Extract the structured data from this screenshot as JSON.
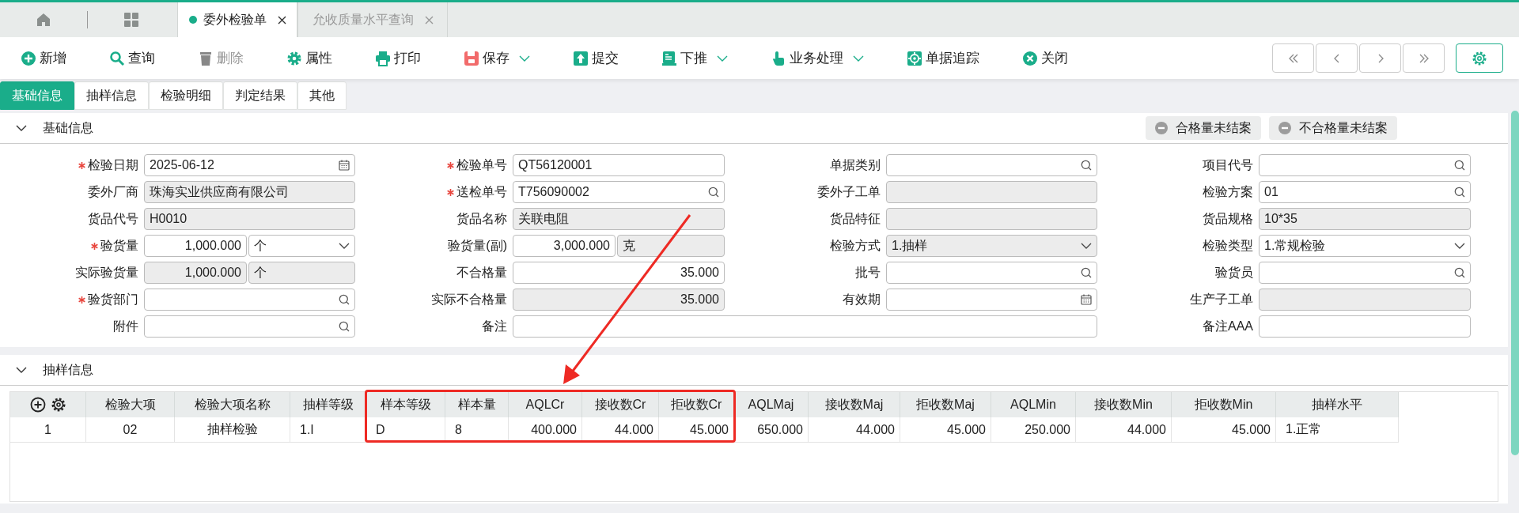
{
  "page_tabs": [
    {
      "label": "委外检验单",
      "selected": true
    },
    {
      "label": "允收质量水平查询",
      "selected": false
    }
  ],
  "toolbar": [
    {
      "label": "新增",
      "kind": "plus",
      "disabled": false,
      "dropdown": false
    },
    {
      "label": "查询",
      "kind": "search",
      "disabled": false,
      "dropdown": false
    },
    {
      "label": "删除",
      "kind": "trash",
      "disabled": true,
      "dropdown": false
    },
    {
      "label": "属性",
      "kind": "gear",
      "disabled": false,
      "dropdown": false
    },
    {
      "label": "打印",
      "kind": "printer",
      "disabled": false,
      "dropdown": false
    },
    {
      "label": "保存",
      "kind": "save",
      "disabled": false,
      "dropdown": true
    },
    {
      "label": "提交",
      "kind": "upload",
      "disabled": false,
      "dropdown": false
    },
    {
      "label": "下推",
      "kind": "document",
      "disabled": false,
      "dropdown": true
    },
    {
      "label": "业务处理",
      "kind": "hand",
      "disabled": false,
      "dropdown": true
    },
    {
      "label": "单据追踪",
      "kind": "target",
      "disabled": false,
      "dropdown": false
    },
    {
      "label": "关闭",
      "kind": "close",
      "disabled": false,
      "dropdown": false
    }
  ],
  "form_tabs": [
    {
      "label": "基础信息",
      "selected": true
    },
    {
      "label": "抽样信息",
      "selected": false
    },
    {
      "label": "检验明细",
      "selected": false
    },
    {
      "label": "判定结果",
      "selected": false
    },
    {
      "label": "其他",
      "selected": false
    }
  ],
  "basic_section": {
    "title": "基础信息",
    "expanded": true,
    "status_buttons": [
      "合格量未结案",
      "不合格量未结案"
    ],
    "rows": [
      [
        {
          "label": "检验日期",
          "required": true,
          "kind": "date",
          "readonly": false,
          "value": "2025-06-12"
        },
        {
          "label": "检验单号",
          "required": true,
          "kind": "text",
          "readonly": false,
          "value": "QT56120001"
        },
        {
          "label": "单据类别",
          "required": false,
          "kind": "search",
          "readonly": false
        },
        {
          "label": "项目代号",
          "required": false,
          "kind": "search",
          "readonly": false
        }
      ],
      [
        {
          "label": "委外厂商",
          "required": false,
          "kind": "text",
          "readonly": true,
          "value": "珠海实业供应商有限公司"
        },
        {
          "label": "送检单号",
          "required": true,
          "kind": "search",
          "readonly": false,
          "value": "T756090002"
        },
        {
          "label": "委外子工单",
          "required": false,
          "kind": "text",
          "readonly": true
        },
        {
          "label": "检验方案",
          "required": false,
          "kind": "search",
          "readonly": false,
          "value": "01"
        }
      ],
      [
        {
          "label": "货品代号",
          "required": false,
          "kind": "text",
          "readonly": true,
          "value": "H0010"
        },
        {
          "label": "货品名称",
          "required": false,
          "kind": "text",
          "readonly": true,
          "value": "关联电阻"
        },
        {
          "label": "货品特征",
          "required": false,
          "kind": "text",
          "readonly": true
        },
        {
          "label": "货品规格",
          "required": false,
          "kind": "text",
          "readonly": true,
          "value": "10*35"
        }
      ],
      [
        {
          "label": "验货量",
          "required": true,
          "kind": "quantity",
          "readonly": false,
          "value": "1,000.000",
          "unit": {
            "value": "个",
            "kind": "select",
            "readonly": false
          }
        },
        {
          "label": "验货量(副)",
          "required": false,
          "kind": "quantity",
          "readonly": false,
          "value": "3,000.000",
          "unit": {
            "value": "克",
            "kind": "text",
            "readonly": true
          }
        },
        {
          "label": "检验方式",
          "required": false,
          "kind": "select",
          "readonly": true,
          "value": "1.抽样"
        },
        {
          "label": "检验类型",
          "required": false,
          "kind": "select",
          "readonly": false,
          "value": "1.常规检验"
        }
      ],
      [
        {
          "label": "实际验货量",
          "required": false,
          "kind": "quantity",
          "readonly": true,
          "value": "1,000.000",
          "unit": {
            "value": "个",
            "kind": "text",
            "readonly": true
          }
        },
        {
          "label": "不合格量",
          "required": false,
          "kind": "number",
          "readonly": false,
          "value": "35.000"
        },
        {
          "label": "批号",
          "required": false,
          "kind": "search",
          "readonly": false
        },
        {
          "label": "验货员",
          "required": false,
          "kind": "search",
          "readonly": false
        }
      ],
      [
        {
          "label": "验货部门",
          "required": true,
          "kind": "search",
          "readonly": false
        },
        {
          "label": "实际不合格量",
          "required": false,
          "kind": "number",
          "readonly": true,
          "value": "35.000"
        },
        {
          "label": "有效期",
          "required": false,
          "kind": "date",
          "readonly": false
        },
        {
          "label": "生产子工单",
          "required": false,
          "kind": "text",
          "readonly": true
        }
      ],
      [
        {
          "label": "附件",
          "required": false,
          "kind": "search",
          "readonly": false
        },
        {
          "label": "备注",
          "required": false,
          "kind": "text",
          "readonly": false,
          "colspan": 2
        },
        {
          "label": "备注AAA",
          "required": false,
          "kind": "text",
          "readonly": false
        }
      ]
    ]
  },
  "sampling_section": {
    "title": "抽样信息",
    "expanded": true,
    "table": {
      "columns": [
        {
          "label": "检验大项",
          "highlighted": false
        },
        {
          "label": "检验大项名称",
          "highlighted": false
        },
        {
          "label": "抽样等级",
          "highlighted": false
        },
        {
          "label": "样本等级",
          "highlighted": true
        },
        {
          "label": "样本量",
          "highlighted": true
        },
        {
          "label": "AQLCr",
          "highlighted": true
        },
        {
          "label": "接收数Cr",
          "highlighted": true
        },
        {
          "label": "拒收数Cr",
          "highlighted": true
        },
        {
          "label": "AQLMaj",
          "highlighted": false
        },
        {
          "label": "接收数Maj",
          "highlighted": false
        },
        {
          "label": "拒收数Maj",
          "highlighted": false
        },
        {
          "label": "AQLMin",
          "highlighted": false
        },
        {
          "label": "接收数Min",
          "highlighted": false
        },
        {
          "label": "拒收数Min",
          "highlighted": false
        },
        {
          "label": "抽样水平",
          "highlighted": false
        }
      ],
      "rows": [
        {
          "index": "1",
          "cells": [
            "02",
            "抽样检验",
            "1.I",
            "D",
            "8",
            "400.000",
            "44.000",
            "45.000",
            "650.000",
            "44.000",
            "45.000",
            "250.000",
            "44.000",
            "45.000",
            "1.正常"
          ]
        }
      ]
    }
  }
}
